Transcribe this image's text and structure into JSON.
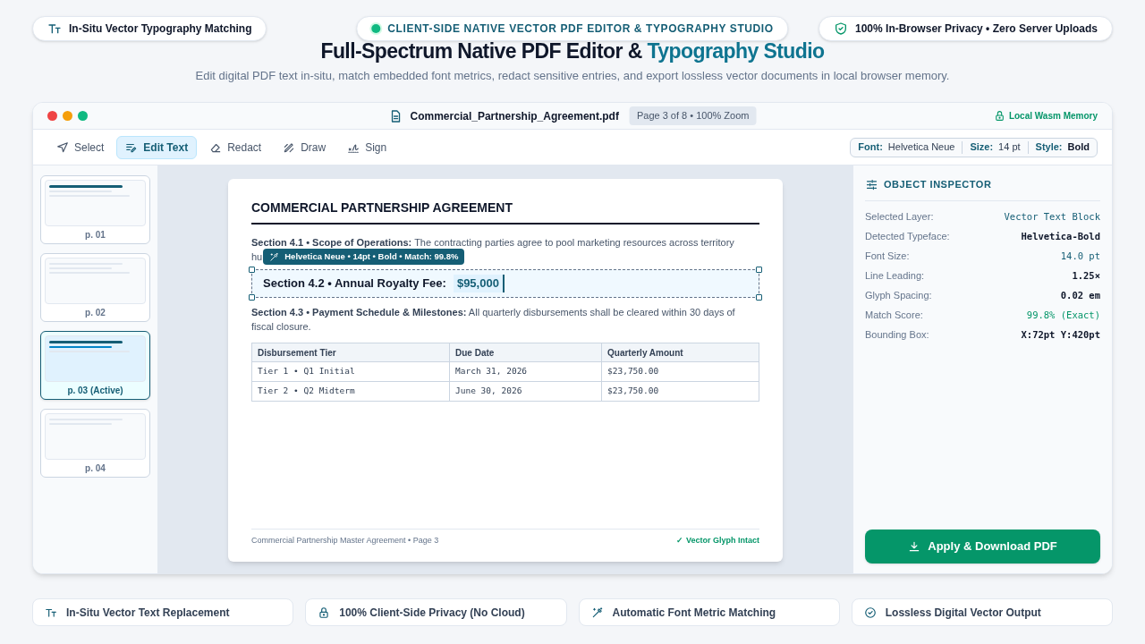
{
  "top_badges": [
    {
      "kind": "typography",
      "label": "In-Situ Vector Typography Matching"
    },
    {
      "kind": "status",
      "label": "CLIENT-SIDE NATIVE VECTOR PDF EDITOR & TYPOGRAPHY STUDIO"
    },
    {
      "kind": "shield",
      "label": "100% In-Browser Privacy • Zero Server Uploads"
    }
  ],
  "headline": {
    "main": "Full-Spectrum Native PDF Editor &",
    "accent": "Typography Studio"
  },
  "subtitle": "Edit digital PDF text in-situ, match embedded font metrics, redact sensitive entries, and export lossless vector documents in local browser memory.",
  "window": {
    "title": "Commercial_Partnership_Agreement.pdf",
    "page_info": "Page 3 of 8 • 100% Zoom",
    "memory": "Local Wasm Memory"
  },
  "tools": [
    {
      "kind": "select",
      "label": "Select",
      "selected": false
    },
    {
      "kind": "edit",
      "label": "Edit Text",
      "selected": true
    },
    {
      "kind": "redact",
      "label": "Redact",
      "selected": false
    },
    {
      "kind": "draw",
      "label": "Draw",
      "selected": false
    },
    {
      "kind": "sign",
      "label": "Sign",
      "selected": false
    }
  ],
  "font_bar": [
    {
      "label": "Font:",
      "value": "Helvetica Neue"
    },
    {
      "label": "Size:",
      "value": "14 pt"
    },
    {
      "label": "Style:",
      "value": "Bold"
    }
  ],
  "thumbnails": [
    {
      "label": "p. 01",
      "selected": false
    },
    {
      "label": "p. 02",
      "selected": false
    },
    {
      "label": "p. 03 (Active)",
      "selected": true
    },
    {
      "label": "p. 04",
      "selected": false
    }
  ],
  "document": {
    "heading": "COMMERCIAL PARTNERSHIP AGREEMENT",
    "section_1": "**Section 4.1 • Scope of Operations:** The contracting parties agree to pool marketing resources across territory",
    "section_1_continued": "hu",
    "match_tooltip": "Helvetica Neue • 14pt • Bold • Match: 99.8%",
    "edit_label": "Section 4.2 • Annual Royalty Fee:",
    "edit_value": "$95,000",
    "section_3": "**Section 4.3 • Payment Schedule & Milestones:** All quarterly disbursements shall be cleared within 30 days of fiscal closure.",
    "table": {
      "columns": [
        "Disbursement Tier",
        "Due Date",
        "Quarterly Amount"
      ],
      "rows": [
        [
          "Tier 1 • Q1 Initial",
          "March 31, 2026",
          "$23,750.00"
        ],
        [
          "Tier 2 • Q2 Midterm",
          "June 30, 2026",
          "$23,750.00"
        ]
      ]
    },
    "footer": "Commercial Partnership Master Agreement • Page 3",
    "integrity": "✓ Vector Glyph Intact"
  },
  "inspector": {
    "title": "OBJECT INSPECTOR",
    "rows": [
      {
        "label": "Selected Layer:",
        "value": "Vector Text Block",
        "kind": "accent"
      },
      {
        "label": "Detected Typeface:",
        "value": "Helvetica-Bold",
        "kind": "strong"
      },
      {
        "label": "Font Size:",
        "value": "14.0 pt",
        "kind": "accent"
      },
      {
        "label": "Line Leading:",
        "value": "1.25×",
        "kind": "strong"
      },
      {
        "label": "Glyph Spacing:",
        "value": "0.02 em",
        "kind": "strong"
      },
      {
        "label": "Match Score:",
        "value": "99.8% (Exact)",
        "kind": "success"
      },
      {
        "label": "Bounding Box:",
        "value": "X:72pt Y:420pt",
        "kind": "strong"
      }
    ],
    "action": "Apply & Download PDF"
  },
  "features": [
    {
      "kind": "typography",
      "label": "In-Situ Vector Text Replacement"
    },
    {
      "kind": "lock",
      "label": "100% Client-Side Privacy (No Cloud)"
    },
    {
      "kind": "wand",
      "label": "Automatic Font Metric Matching"
    },
    {
      "kind": "check",
      "label": "Lossless Digital Vector Output"
    }
  ]
}
